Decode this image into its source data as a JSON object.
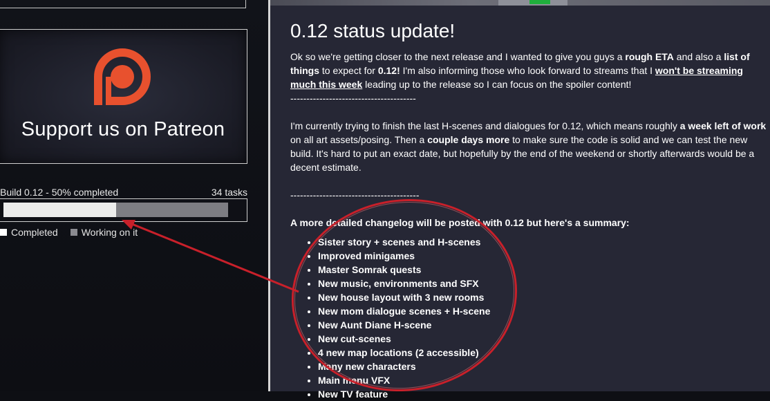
{
  "sidebar": {
    "patreon_label": "Support us on Patreon",
    "progress": {
      "label": "Build 0.12 - 50% completed",
      "count": "34 tasks",
      "completed_fraction": 0.5
    },
    "legend": [
      {
        "label": "Completed",
        "color": "#ffffff"
      },
      {
        "label": "Working on it",
        "color": "#8a8a90"
      }
    ]
  },
  "post": {
    "title": "0.12 status update!",
    "p1": {
      "t1": "Ok so we're getting closer to the next release and I wanted to give you guys a ",
      "b1": "rough ETA",
      "t2": " and also a ",
      "b2": "list of things",
      "t3": " to expect for ",
      "b3": "0.12!",
      "t4": " I'm also informing those who look forward to streams that I ",
      "u1": "won't be streaming much this week",
      "t5": " leading up to the release so I can focus on the spoiler content!"
    },
    "separator1": "---------------------------------------",
    "p2": {
      "t1": "I'm currently trying to finish the last H-scenes and dialogues for 0.12, which means roughly ",
      "b1": "a week left of work",
      "t2": " on all art assets/posing. Then a ",
      "b2": "couple days more",
      "t3": " to make sure the code is solid and we can test the new build. It's hard to put an exact date, but hopefully by the end of the weekend or shortly afterwards would be a decent estimate."
    },
    "separator2": "----------------------------------------",
    "summary_heading": "A more detailed changelog will be posted with 0.12 but here's a summary:",
    "changes": [
      "Sister story + scenes and H-scenes",
      "Improved minigames",
      "Master Somrak quests",
      "New music, environments and SFX",
      "New house layout with 3 new rooms",
      "New mom dialogue scenes + H-scene",
      "New Aunt Diane H-scene",
      "New cut-scenes",
      "4 new map locations (2 accessible)",
      "Many new characters",
      "Main menu VFX",
      "New TV feature"
    ]
  },
  "annotation": {
    "color": "#c8202a"
  },
  "brand": {
    "patreon_color": "#e8512e"
  }
}
